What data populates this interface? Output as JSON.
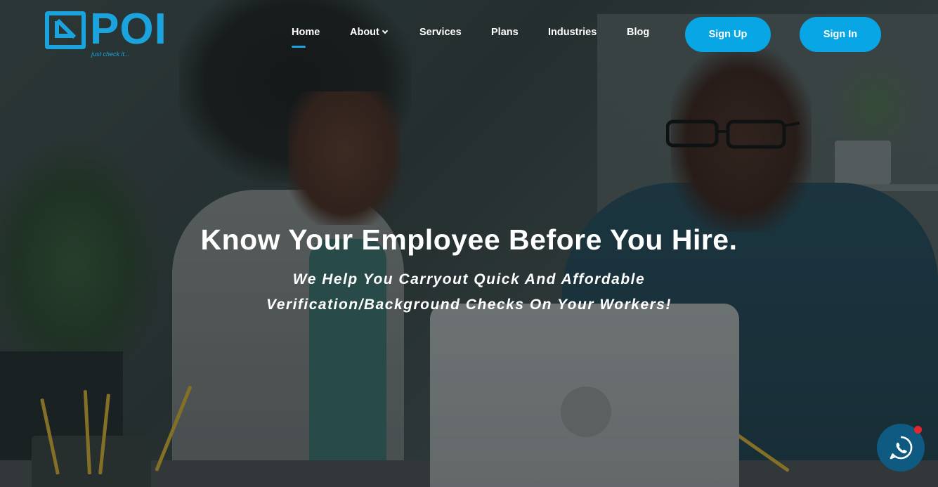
{
  "brand": {
    "name": "POI",
    "tagline": "just check it...",
    "accent_color": "#1ba3de"
  },
  "nav": {
    "items": [
      {
        "label": "Home",
        "active": true
      },
      {
        "label": "About",
        "has_dropdown": true
      },
      {
        "label": "Services"
      },
      {
        "label": "Plans"
      },
      {
        "label": "Industries"
      },
      {
        "label": "Blog"
      }
    ]
  },
  "auth": {
    "signup_label": "Sign Up",
    "signin_label": "Sign In",
    "button_color": "#08a6e4"
  },
  "hero": {
    "title": "Know Your Employee Before You Hire.",
    "subtitle_line1": "We Help You Carryout Quick And Affordable",
    "subtitle_line2": "Verification/Background Checks On Your Workers!"
  },
  "chat_widget": {
    "icon": "whatsapp-icon",
    "background_color": "#0e5a80",
    "notification_color": "#e5262b"
  }
}
